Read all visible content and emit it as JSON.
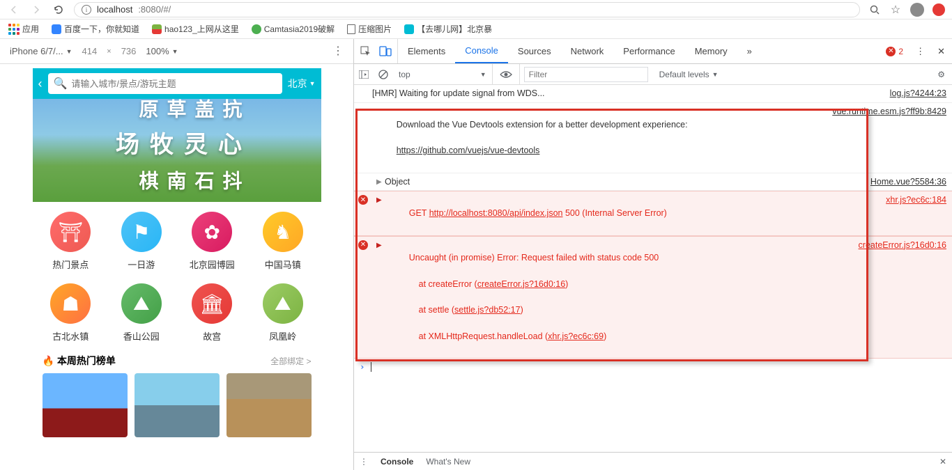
{
  "browser": {
    "url_host": "localhost",
    "url_rest": ":8080/#/"
  },
  "bookmarks": {
    "apps": "应用",
    "baidu": "百度一下，你就知道",
    "hao123": "hao123_上网从这里",
    "camtasia": "Camtasia2019破解",
    "compress": "压缩图片",
    "qunar": "【去哪儿网】北京暴"
  },
  "device": {
    "name": "iPhone 6/7/...",
    "width": "414",
    "height": "736",
    "zoom": "100%"
  },
  "app": {
    "search_placeholder": "请输入城市/景点/游玩主题",
    "city": "北京",
    "hero_lines": [
      "心灵牧场",
      "抗盖草原",
      "抖石南棋"
    ],
    "grid": [
      {
        "label": "热门景点",
        "cls": "c-red",
        "glyph": "⛩"
      },
      {
        "label": "一日游",
        "cls": "c-blue",
        "glyph": "⚑"
      },
      {
        "label": "北京园博园",
        "cls": "c-pink",
        "glyph": "✿"
      },
      {
        "label": "中国马镇",
        "cls": "c-yellow",
        "glyph": "♞"
      },
      {
        "label": "古北水镇",
        "cls": "c-orange",
        "glyph": "☗"
      },
      {
        "label": "香山公园",
        "cls": "c-green",
        "glyph": "⛰"
      },
      {
        "label": "故宫",
        "cls": "c-red2",
        "glyph": "🏛"
      },
      {
        "label": "凤凰岭",
        "cls": "c-green2",
        "glyph": "⛰"
      }
    ],
    "section_title": "本周热门榜单",
    "section_more": "全部绑定 >"
  },
  "devtools": {
    "tabs": {
      "elements": "Elements",
      "console": "Console",
      "sources": "Sources",
      "network": "Network",
      "performance": "Performance",
      "memory": "Memory"
    },
    "error_count": "2",
    "toolbar": {
      "context": "top",
      "filter_placeholder": "Filter",
      "levels": "Default levels"
    },
    "log": {
      "hmr": "[HMR] Waiting for update signal from WDS...",
      "hmr_src": "log.js?4244:23",
      "vue_dl": "Download the Vue Devtools extension for a better development experience:",
      "vue_link": "https://github.com/vuejs/vue-devtools",
      "vue_src": "vue.runtime.esm.js?ff9b:8429",
      "object": "Object",
      "object_src": "Home.vue?5584:36",
      "get": "GET ",
      "get_url": "http://localhost:8080/api/index.json",
      "get_status": " 500 (Internal Server Error)",
      "get_src": "xhr.js?ec6c:184",
      "uncaught": "Uncaught (in promise) Error: Request failed with status code 500",
      "uncaught_l2_pre": "    at createError (",
      "uncaught_l2_link": "createError.js?16d0:16",
      "uncaught_l3_pre": "    at settle (",
      "uncaught_l3_link": "settle.js?db52:17",
      "uncaught_l4_pre": "    at XMLHttpRequest.handleLoad (",
      "uncaught_l4_link": "xhr.js?ec6c:69",
      "close_paren": ")",
      "uncaught_src": "createError.js?16d0:16"
    },
    "drawer": {
      "console": "Console",
      "whatsnew": "What's New"
    }
  }
}
